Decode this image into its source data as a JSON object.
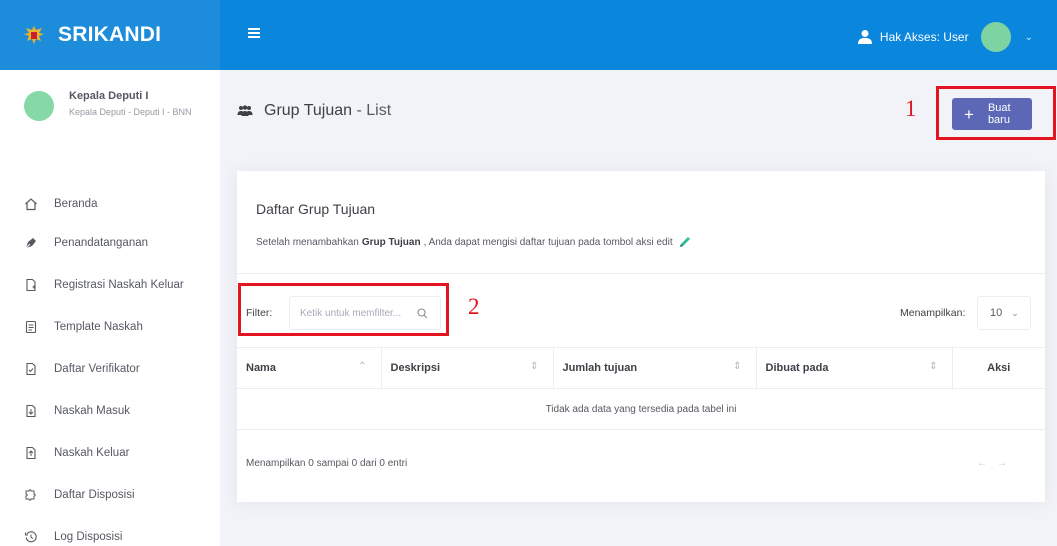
{
  "brand": {
    "name": "SRIKANDI",
    "logo_icon": "garuda-emblem-icon"
  },
  "header": {
    "menu_icon": "hamburger-icon",
    "role_label": "Hak Akses: User",
    "user_icon": "user-icon",
    "avatar_color": "#7ed3a2"
  },
  "profile": {
    "name": "Kepala Deputi I",
    "subtitle": "Kepala Deputi - Deputi I - BNN"
  },
  "sidebar": {
    "items": [
      {
        "label": "Beranda",
        "icon": "home-icon"
      },
      {
        "label": "Penandatanganan",
        "icon": "pen-nib-icon"
      },
      {
        "label": "Registrasi Naskah Keluar",
        "icon": "file-add-icon"
      },
      {
        "label": "Template Naskah",
        "icon": "document-icon"
      },
      {
        "label": "Daftar Verifikator",
        "icon": "file-check-icon"
      },
      {
        "label": "Naskah Masuk",
        "icon": "file-download-icon"
      },
      {
        "label": "Naskah Keluar",
        "icon": "file-upload-icon"
      },
      {
        "label": "Daftar Disposisi",
        "icon": "puzzle-icon"
      },
      {
        "label": "Log Disposisi",
        "icon": "history-icon"
      }
    ]
  },
  "page": {
    "title": "Grup Tujuan",
    "title_suffix": " - List",
    "title_icon": "users-icon",
    "new_button": {
      "plus": "+",
      "label": "Buat baru"
    }
  },
  "annotations": {
    "one": "1",
    "two": "2",
    "color": "#e3141f"
  },
  "panel": {
    "title": "Daftar Grup Tujuan",
    "desc_before": "Setelah menambahkan",
    "desc_bold": "Grup Tujuan",
    "desc_after": ", Anda dapat mengisi daftar tujuan pada tombol aksi edit",
    "filter_label": "Filter:",
    "filter_placeholder": "Ketik untuk memfilter...",
    "show_label": "Menampilkan:",
    "show_value": "10"
  },
  "table": {
    "columns": [
      "Nama",
      "Deskripsi",
      "Jumlah tujuan",
      "Dibuat pada",
      "Aksi"
    ],
    "empty_message": "Tidak ada data yang tersedia pada tabel ini"
  },
  "footer": {
    "info": "Menampilkan 0 sampai 0 dari 0 entri",
    "prev": "←",
    "next": "→"
  },
  "colors": {
    "brand": "#1d8ddb",
    "header": "#0a86dc",
    "primary_button": "#5c67b5",
    "sidebar_bg": "#ffffff",
    "content_bg": "#f2f3f8"
  }
}
